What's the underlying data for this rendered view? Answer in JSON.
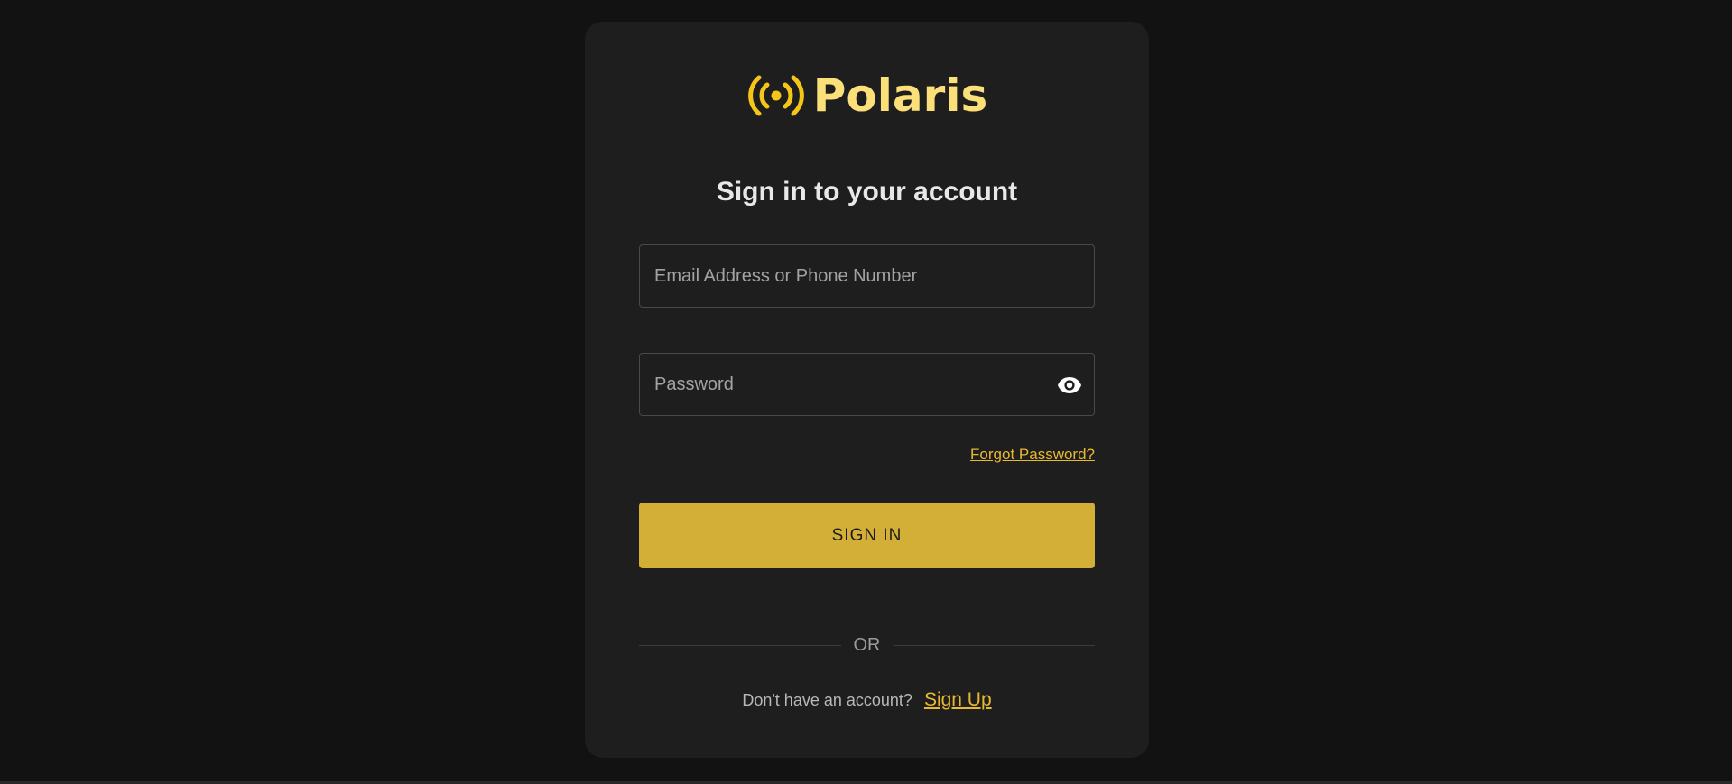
{
  "brand": {
    "name": "Polaris",
    "icon": "broadcast-icon",
    "color": "#fbe07a",
    "icon_color": "#f5c518"
  },
  "title": "Sign in to your account",
  "form": {
    "email_placeholder": "Email Address or Phone Number",
    "email_value": "",
    "password_placeholder": "Password",
    "password_value": "",
    "show_password_icon": "eye-icon",
    "forgot_password": "Forgot Password?",
    "submit_label": "SIGN IN"
  },
  "divider_text": "OR",
  "signup": {
    "prompt": "Don't have an account?",
    "link": "Sign Up"
  },
  "colors": {
    "background": "#121212",
    "card": "#1e1e1e",
    "accent": "#d4af37",
    "link": "#e8b830"
  }
}
